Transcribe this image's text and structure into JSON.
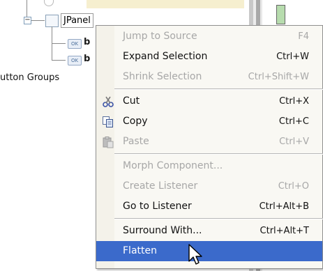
{
  "tree": {
    "panel_label": "JPanel",
    "child_icon_label": "OK",
    "child_fragment": "b",
    "button_groups_label": "utton Groups",
    "expander_symbol": "−"
  },
  "context_menu": {
    "items": [
      {
        "label": "Jump to Source",
        "accelerator": "F4",
        "enabled": false
      },
      {
        "label": "Expand Selection",
        "accelerator": "Ctrl+W",
        "enabled": true
      },
      {
        "label": "Shrink Selection",
        "accelerator": "Ctrl+Shift+W",
        "enabled": false
      },
      {
        "label": "Cut",
        "accelerator": "Ctrl+X",
        "enabled": true,
        "icon": "scissors-icon"
      },
      {
        "label": "Copy",
        "accelerator": "Ctrl+C",
        "enabled": true,
        "icon": "copy-icon"
      },
      {
        "label": "Paste",
        "accelerator": "Ctrl+V",
        "enabled": false,
        "icon": "paste-icon"
      },
      {
        "label": "Morph Component...",
        "accelerator": "",
        "enabled": false
      },
      {
        "label": "Create Listener",
        "accelerator": "Ctrl+O",
        "enabled": false
      },
      {
        "label": "Go to Listener",
        "accelerator": "Ctrl+Alt+B",
        "enabled": true
      },
      {
        "label": "Surround With...",
        "accelerator": "Ctrl+Alt+T",
        "enabled": true
      },
      {
        "label": "Flatten",
        "accelerator": "",
        "enabled": true,
        "selected": true
      }
    ]
  },
  "colors": {
    "selection": "#3b6acb",
    "menu_background": "#f9f8f3",
    "disabled_text": "#a7a7a7"
  }
}
